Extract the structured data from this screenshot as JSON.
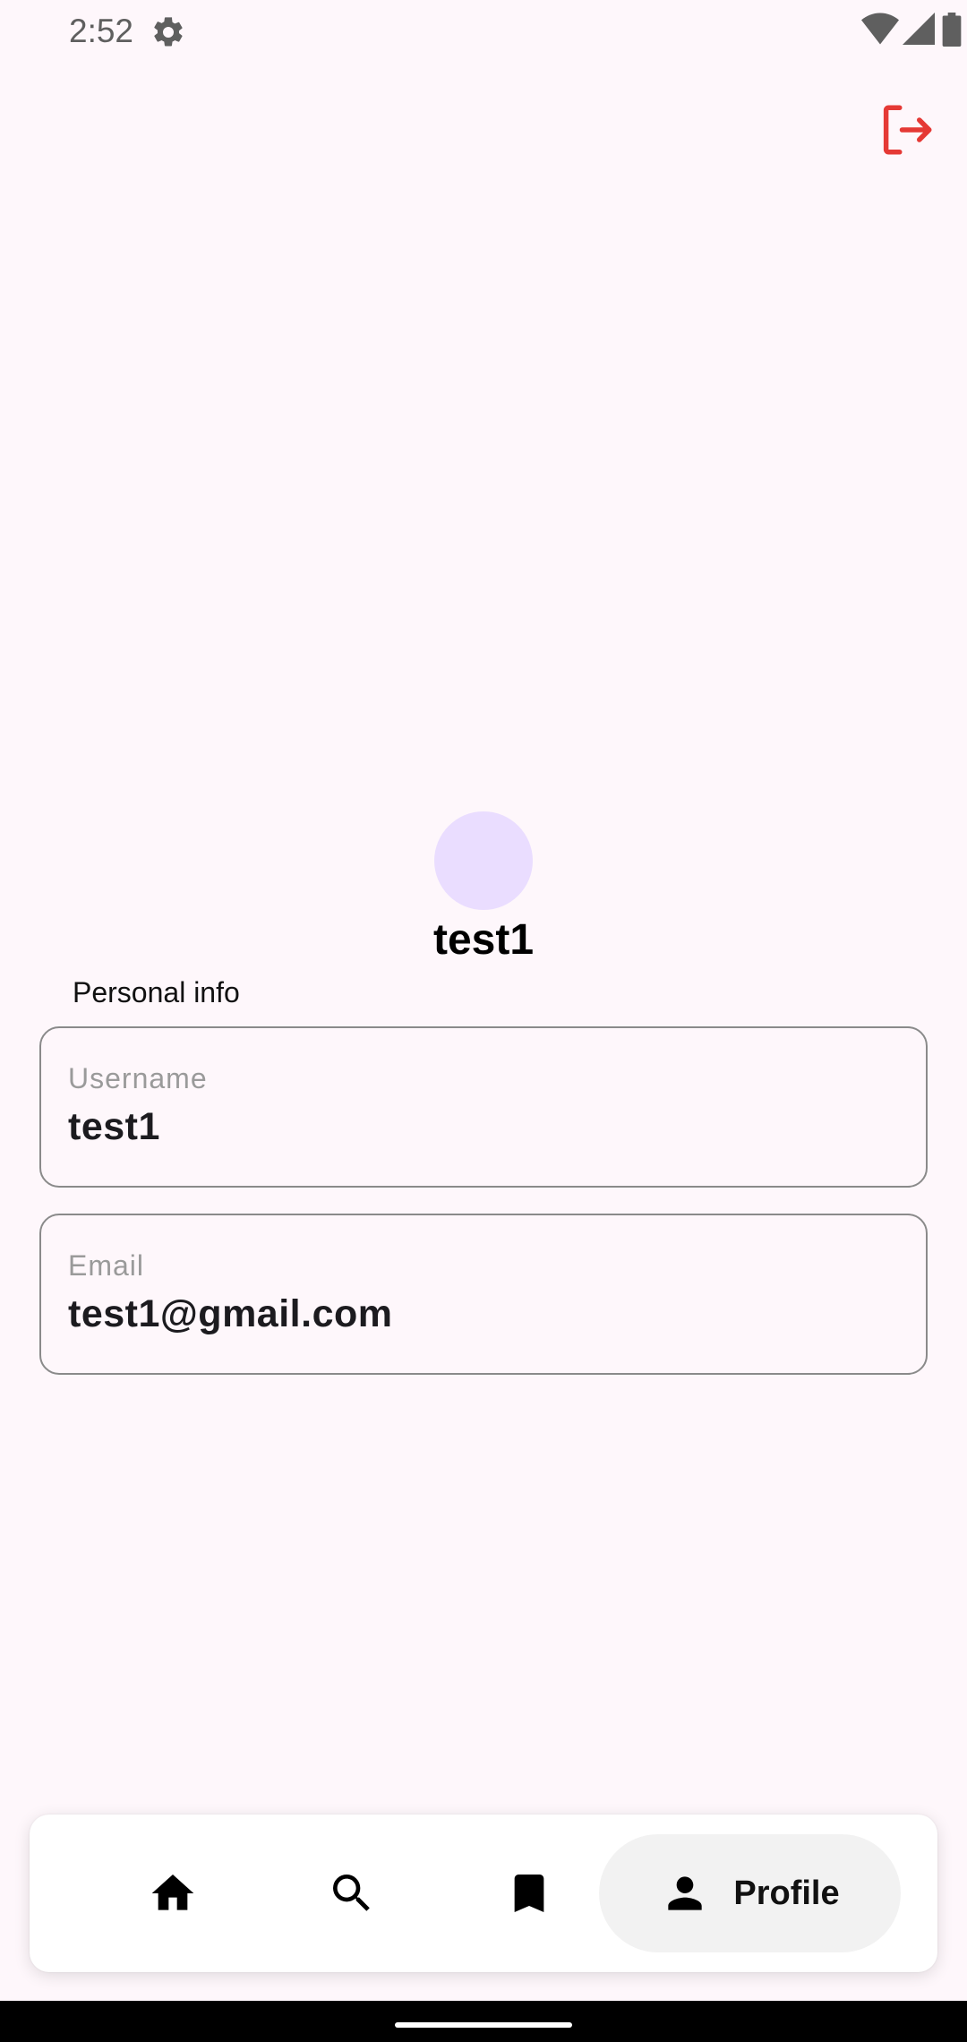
{
  "status_bar": {
    "time": "2:52",
    "icons": [
      "settings-icon",
      "wifi-icon",
      "signal-icon",
      "battery-icon"
    ]
  },
  "header": {
    "logout_icon": "logout-icon",
    "logout_color": "#e53935"
  },
  "profile": {
    "name": "test1",
    "avatar_color": "#eaddff"
  },
  "personal_info": {
    "section_label": "Personal info",
    "username_label": "Username",
    "username_value": "test1",
    "email_label": "Email",
    "email_value": "test1@gmail.com"
  },
  "bottom_nav": {
    "items": [
      {
        "icon": "home-icon"
      },
      {
        "icon": "search-icon"
      },
      {
        "icon": "bookmark-icon"
      },
      {
        "icon": "person-icon",
        "label": "Profile",
        "selected": true
      }
    ]
  }
}
